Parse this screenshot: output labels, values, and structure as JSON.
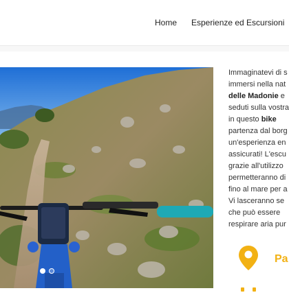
{
  "nav": {
    "home": "Home",
    "experiences": "Esperienze ed Escursioni"
  },
  "article": {
    "line1": "Immaginatevi di s",
    "line2": "immersi nella nat",
    "line3_bold": "delle Madonie",
    "line3_rest": " e",
    "line4": "seduti sulla vostra",
    "line5_pre": "in questo ",
    "line5_bold": "bike",
    "line6": "partenza dal borg",
    "line7": "un'esperienza en",
    "line8": "assicurati! L'escu",
    "line9": "grazie all'utilizzo",
    "line10": "permetteranno di",
    "line11": "fino al mare per a",
    "line12": "Vi lasceranno se",
    "line13": "che può essere",
    "line14": "respirare aria pur"
  },
  "info": {
    "place_label": "Pa"
  },
  "carousel": {
    "slide_count": 2,
    "active_slide": 1
  },
  "colors": {
    "accent": "#f2b114",
    "handlebar_grip": "#1ea9b5",
    "sky": "#2f7fe0"
  },
  "icons": {
    "location": "map-pin-icon",
    "secondary": "sun-icon"
  }
}
